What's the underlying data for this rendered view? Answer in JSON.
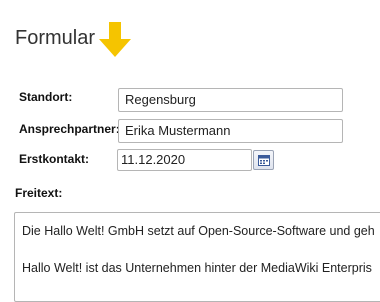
{
  "heading": "Formular",
  "form": {
    "standort": {
      "label": "Standort:",
      "value": "Regensburg"
    },
    "ansprechpartner": {
      "label": "Ansprechpartner:",
      "value": "Erika Mustermann"
    },
    "erstkontakt": {
      "label": "Erstkontakt:",
      "value": "11.12.2020"
    }
  },
  "freitext": {
    "label": "Freitext:",
    "lines": [
      "Die Hallo Welt! GmbH setzt auf Open-Source-Software und geh",
      "Hallo Welt! ist das Unternehmen hinter der MediaWiki Enterpris"
    ]
  },
  "colors": {
    "arrow": "#f5c400"
  },
  "icons": {
    "pointer": "arrow-down-icon",
    "calendar": "calendar-icon"
  }
}
